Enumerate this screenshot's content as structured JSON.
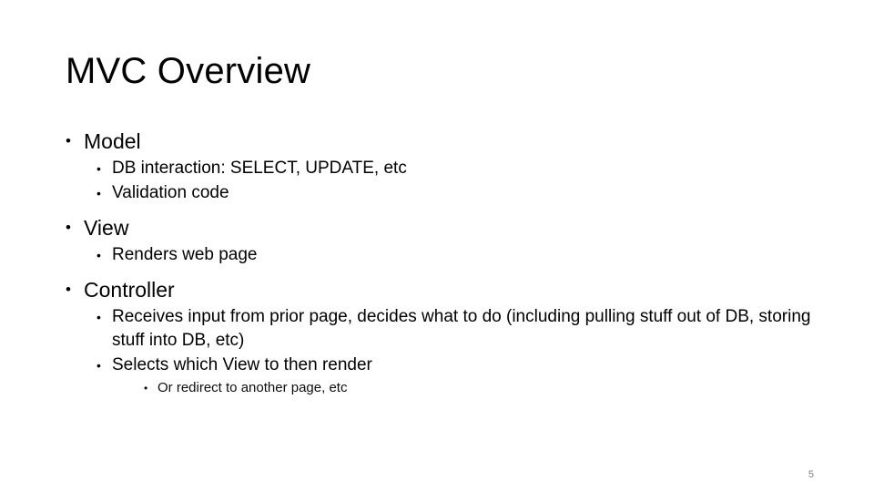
{
  "slide": {
    "title": "MVC Overview",
    "page_number": "5",
    "background_color": "#ffffff",
    "text_color": "#000000",
    "page_number_color": "#808080",
    "bullet_glyph": "•",
    "groups": [
      {
        "level1": "Model",
        "level2": [
          {
            "text": "DB interaction: SELECT, UPDATE, etc",
            "level3": []
          },
          {
            "text": "Validation code",
            "level3": []
          }
        ]
      },
      {
        "level1": "View",
        "level2": [
          {
            "text": "Renders web page",
            "level3": []
          }
        ]
      },
      {
        "level1": "Controller",
        "level2": [
          {
            "text": "Receives input from prior page, decides what to do (including pulling stuff out of DB, storing stuff into DB, etc)",
            "level3": []
          },
          {
            "text": "Selects which View to then render",
            "level3": [
              "Or redirect to another page, etc"
            ]
          }
        ]
      }
    ]
  }
}
